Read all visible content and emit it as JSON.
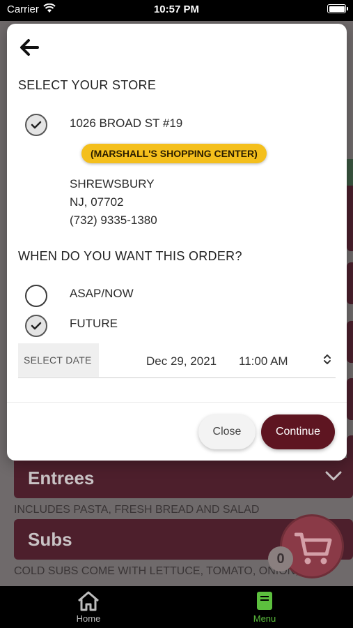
{
  "status_bar": {
    "carrier": "Carrier",
    "time": "10:57 PM"
  },
  "modal": {
    "back_icon": "arrow-left-icon",
    "store_heading": "SELECT YOUR STORE",
    "store": {
      "address_line1": "1026 BROAD ST #19",
      "location_name": "(MARSHALL'S SHOPPING CENTER)",
      "city": "SHREWSBURY",
      "state_zip": "NJ, 07702",
      "phone": "(732) 9335-1380",
      "selected": true
    },
    "order_time_heading": "WHEN DO YOU WANT THIS ORDER?",
    "options": [
      {
        "label": "ASAP/NOW",
        "selected": false
      },
      {
        "label": "FUTURE",
        "selected": true
      }
    ],
    "date_picker": {
      "label": "SELECT DATE",
      "date": "Dec 29, 2021",
      "time": "11:00 AM"
    },
    "close_label": "Close",
    "continue_label": "Continue"
  },
  "background": {
    "sections": [
      {
        "title": "Entrees",
        "description": "INCLUDES PASTA, FRESH BREAD AND SALAD"
      },
      {
        "title": "Subs",
        "description": "COLD SUBS COME WITH LETTUCE, TOMATO, ONION, OIL"
      }
    ],
    "cart_count": "0"
  },
  "tab_bar": {
    "items": [
      {
        "label": "Home",
        "icon": "home-icon",
        "active": false
      },
      {
        "label": "Menu",
        "icon": "menu-book-icon",
        "active": true
      }
    ]
  },
  "colors": {
    "accent": "#5e1521",
    "badge": "#f4bf1c",
    "active_tab": "#5cbf3e"
  }
}
